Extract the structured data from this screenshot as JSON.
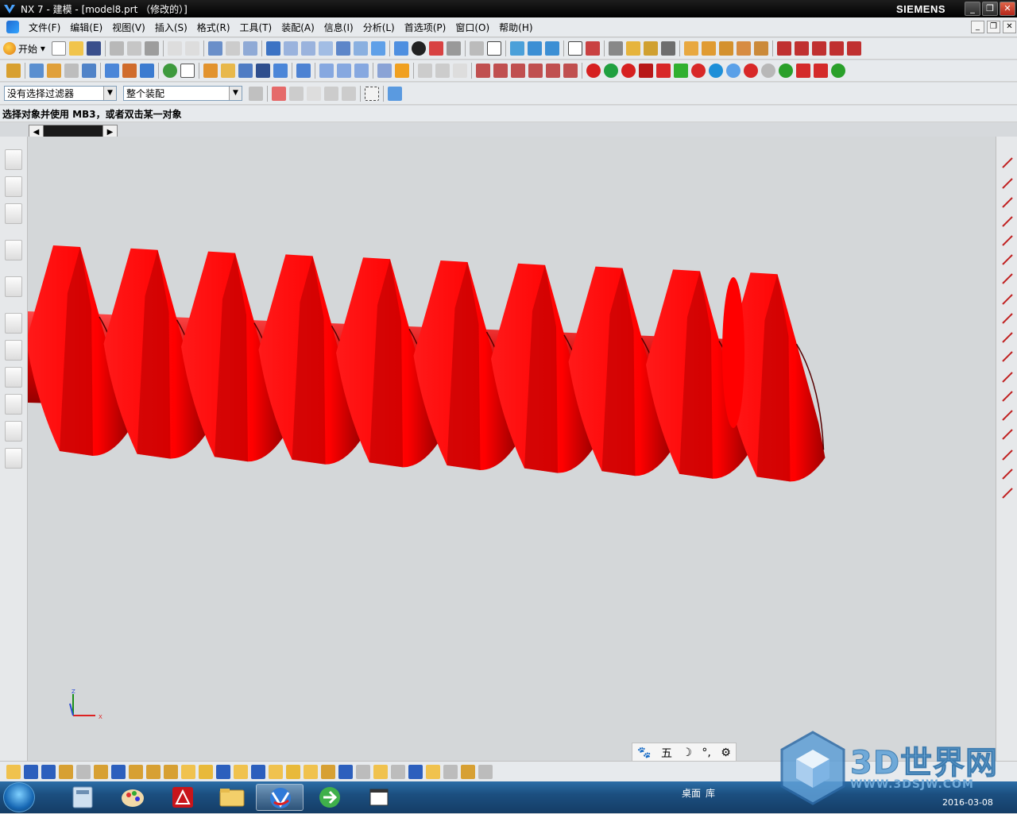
{
  "window": {
    "title": "NX 7 - 建模 - [model8.prt （修改的）]",
    "brand": "SIEMENS",
    "controls": {
      "minimize": "_",
      "restore": "❐",
      "close": "✕"
    }
  },
  "menu": {
    "items": [
      "文件(F)",
      "编辑(E)",
      "视图(V)",
      "插入(S)",
      "格式(R)",
      "工具(T)",
      "装配(A)",
      "信息(I)",
      "分析(L)",
      "首选项(P)",
      "窗口(O)",
      "帮助(H)"
    ]
  },
  "toolbar": {
    "start_label": "开始",
    "filter_value": "没有选择过滤器",
    "scope_value": "整个装配"
  },
  "cue": {
    "text": "选择对象并使用 MB3，或者双击某一对象"
  },
  "ime": {
    "items": [
      "🐾",
      "五",
      "☽",
      "°,",
      "⚙"
    ]
  },
  "watermark": {
    "title": "3D世界网",
    "url": "WWW.3DSJW.COM"
  },
  "taskbar": {
    "desktop_label": "桌面",
    "library_label": "库",
    "date": "2016-03-08"
  },
  "axes": {
    "z": "Z",
    "x": "X"
  },
  "colors": {
    "model": "#ff0000",
    "model_dark": "#b30000",
    "viewport": "#d4d7d9"
  }
}
